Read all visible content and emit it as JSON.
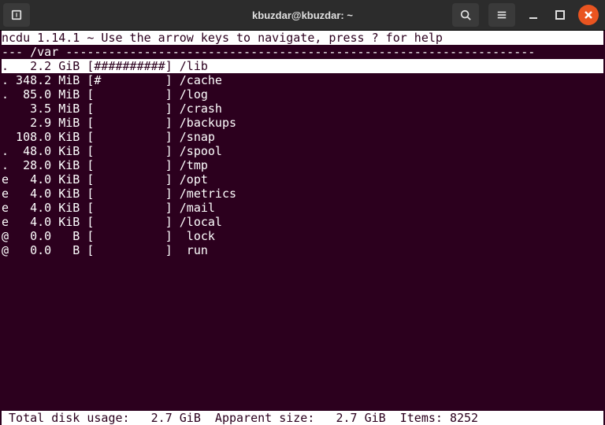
{
  "window": {
    "title": "kbuzdar@kbuzdar: ~"
  },
  "header": "ncdu 1.14.1 ~ Use the arrow keys to navigate, press ? for help",
  "path_line": "--- /var ------------------------------------------------------------------",
  "rows": [
    {
      "flag": ".",
      "size": "   2.2",
      "unit": "GiB",
      "bar": "##########",
      "name": "/lib",
      "selected": true
    },
    {
      "flag": ".",
      "size": " 348.2",
      "unit": "MiB",
      "bar": "#         ",
      "name": "/cache",
      "selected": false
    },
    {
      "flag": ".",
      "size": "  85.0",
      "unit": "MiB",
      "bar": "          ",
      "name": "/log",
      "selected": false
    },
    {
      "flag": " ",
      "size": "   3.5",
      "unit": "MiB",
      "bar": "          ",
      "name": "/crash",
      "selected": false
    },
    {
      "flag": " ",
      "size": "   2.9",
      "unit": "MiB",
      "bar": "          ",
      "name": "/backups",
      "selected": false
    },
    {
      "flag": " ",
      "size": " 108.0",
      "unit": "KiB",
      "bar": "          ",
      "name": "/snap",
      "selected": false
    },
    {
      "flag": ".",
      "size": "  48.0",
      "unit": "KiB",
      "bar": "          ",
      "name": "/spool",
      "selected": false
    },
    {
      "flag": ".",
      "size": "  28.0",
      "unit": "KiB",
      "bar": "          ",
      "name": "/tmp",
      "selected": false
    },
    {
      "flag": "e",
      "size": "   4.0",
      "unit": "KiB",
      "bar": "          ",
      "name": "/opt",
      "selected": false
    },
    {
      "flag": "e",
      "size": "   4.0",
      "unit": "KiB",
      "bar": "          ",
      "name": "/metrics",
      "selected": false
    },
    {
      "flag": "e",
      "size": "   4.0",
      "unit": "KiB",
      "bar": "          ",
      "name": "/mail",
      "selected": false
    },
    {
      "flag": "e",
      "size": "   4.0",
      "unit": "KiB",
      "bar": "          ",
      "name": "/local",
      "selected": false
    },
    {
      "flag": "@",
      "size": "   0.0",
      "unit": "  B",
      "bar": "          ",
      "name": " lock",
      "selected": false
    },
    {
      "flag": "@",
      "size": "   0.0",
      "unit": "  B",
      "bar": "          ",
      "name": " run",
      "selected": false
    }
  ],
  "footer": " Total disk usage:   2.7 GiB  Apparent size:   2.7 GiB  Items: 8252"
}
